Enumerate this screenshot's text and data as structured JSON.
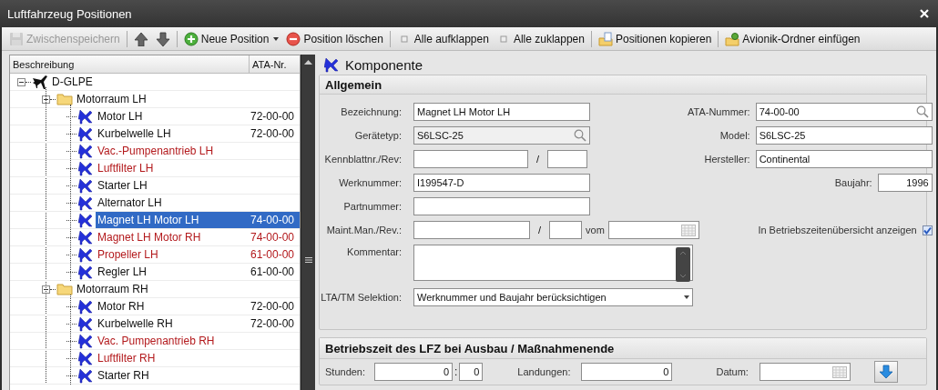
{
  "window": {
    "title": "Luftfahrzeug Positionen"
  },
  "toolbar": [
    [
      {
        "kind": "save",
        "label": "Zwischenspeichern",
        "disabled": true
      }
    ],
    [
      {
        "kind": "up"
      },
      {
        "kind": "down"
      }
    ],
    [
      {
        "kind": "add",
        "label": "Neue Position",
        "dropdown": true
      },
      {
        "kind": "delete",
        "label": "Position löschen"
      }
    ],
    [
      {
        "kind": "expand",
        "label": "Alle aufklappen"
      },
      {
        "kind": "collapse",
        "label": "Alle zuklappen"
      }
    ],
    [
      {
        "kind": "copy",
        "label": "Positionen kopieren"
      }
    ],
    [
      {
        "kind": "avionics",
        "label": "Avionik-Ordner einfügen"
      }
    ]
  ],
  "tree": {
    "columns": [
      "Beschreibung",
      "ATA-Nr."
    ],
    "nodes": [
      {
        "label": "D-GLPE",
        "kind": "aircraft",
        "expanded": true,
        "children": [
          {
            "label": "Motorraum LH",
            "kind": "folder",
            "expanded": true,
            "children": [
              {
                "label": "Motor LH",
                "kind": "component",
                "ata": "72-00-00",
                "flagged": false,
                "selected": false
              },
              {
                "label": "Kurbelwelle LH",
                "kind": "component",
                "ata": "72-00-00",
                "flagged": false,
                "selected": false
              },
              {
                "label": "Vac.-Pumpenantrieb LH",
                "kind": "component",
                "flagged": true,
                "selected": false
              },
              {
                "label": "Luftfilter LH",
                "kind": "component",
                "flagged": true,
                "selected": false
              },
              {
                "label": "Starter LH",
                "kind": "component",
                "flagged": false,
                "selected": false
              },
              {
                "label": "Alternator LH",
                "kind": "component",
                "flagged": false,
                "selected": false
              },
              {
                "label": "Magnet LH Motor LH",
                "kind": "component",
                "ata": "74-00-00",
                "flagged": false,
                "selected": true
              },
              {
                "label": "Magnet LH Motor RH",
                "kind": "component",
                "ata": "74-00-00",
                "flagged": true,
                "selected": false
              },
              {
                "label": "Propeller LH",
                "kind": "component",
                "ata": "61-00-00",
                "flagged": true,
                "selected": false
              },
              {
                "label": "Regler LH",
                "kind": "component",
                "ata": "61-00-00",
                "flagged": false,
                "selected": false
              }
            ]
          },
          {
            "label": "Motorraum RH",
            "kind": "folder",
            "expanded": true,
            "children": [
              {
                "label": "Motor RH",
                "kind": "component",
                "ata": "72-00-00",
                "flagged": false,
                "selected": false
              },
              {
                "label": "Kurbelwelle RH",
                "kind": "component",
                "ata": "72-00-00",
                "flagged": false,
                "selected": false
              },
              {
                "label": "Vac. Pumpenantrieb RH",
                "kind": "component",
                "flagged": true,
                "selected": false
              },
              {
                "label": "Luftfilter RH",
                "kind": "component",
                "flagged": true,
                "selected": false
              },
              {
                "label": "Starter RH",
                "kind": "component",
                "flagged": false,
                "selected": false
              }
            ]
          }
        ]
      }
    ]
  },
  "detail": {
    "title": "Komponente",
    "general": {
      "title": "Allgemein",
      "bezeichnung": {
        "label": "Bezeichnung:",
        "value": "Magnet LH Motor LH"
      },
      "geraetetyp": {
        "label": "Gerätetyp:",
        "value": "S6LSC-25"
      },
      "kennblatt": {
        "label": "Kennblattnr./Rev:",
        "separator": "/"
      },
      "werknummer": {
        "label": "Werknummer:",
        "value": "I199547-D"
      },
      "partnummer": {
        "label": "Partnummer:"
      },
      "maint": {
        "label": "Maint.Man./Rev.:",
        "separator": "/",
        "date_label": "vom"
      },
      "kommentar": {
        "label": "Kommentar:"
      },
      "selektion": {
        "label": "LTA/TM Selektion:",
        "value": "Werknummer und Baujahr berücksichtigen"
      },
      "ata_nummer": {
        "label": "ATA-Nummer:",
        "value": "74-00-00"
      },
      "model": {
        "label": "Model:",
        "value": "S6LSC-25"
      },
      "hersteller": {
        "label": "Hersteller:",
        "value": "Continental"
      },
      "baujahr": {
        "label": "Baujahr:",
        "value": "1996"
      },
      "overview": {
        "label": "In Betriebszeitenübersicht anzeigen",
        "checked": true
      }
    },
    "operating": {
      "title": "Betriebszeit des LFZ bei Ausbau / Maßnahmenende",
      "hours": {
        "label": "Stunden:",
        "value": "0",
        "separator": ":",
        "minutes": "0"
      },
      "landings": {
        "label": "Landungen:",
        "value": "0"
      },
      "date": {
        "label": "Datum:"
      }
    }
  }
}
